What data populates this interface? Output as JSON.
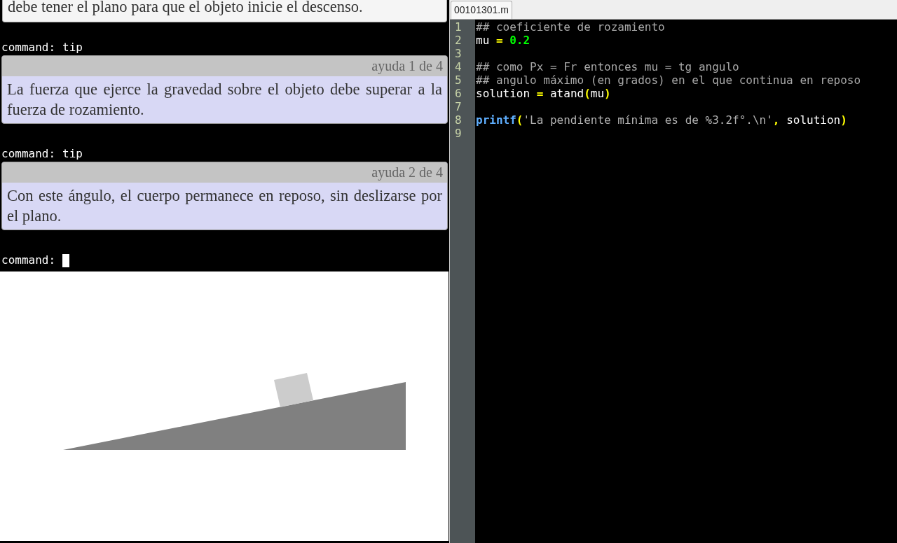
{
  "console": {
    "entries": [
      {
        "kind": "note",
        "text": "debe tener el plano para que el objeto inicie el descenso."
      },
      {
        "kind": "command",
        "prompt": "command:",
        "input": "tip"
      },
      {
        "kind": "tip",
        "header": "ayuda 1 de 4",
        "text": "La fuerza que ejerce la gravedad sobre el objeto debe superar a la fuerza de rozamiento."
      },
      {
        "kind": "command",
        "prompt": "command:",
        "input": "tip"
      },
      {
        "kind": "tip",
        "header": "ayuda 2 de 4",
        "text": "Con este ángulo, el cuerpo permanece en reposo, sin deslizarse por el plano."
      },
      {
        "kind": "prompt",
        "prompt": "command:"
      }
    ]
  },
  "editor": {
    "tab": "00101301.m",
    "lines": [
      {
        "number": "1",
        "tokens": [
          {
            "kind": "comment",
            "text": "## coeficiente de rozamiento"
          }
        ]
      },
      {
        "number": "2",
        "tokens": [
          {
            "kind": "ident",
            "text": "mu "
          },
          {
            "kind": "op",
            "text": "= "
          },
          {
            "kind": "number",
            "text": "0.2"
          }
        ]
      },
      {
        "number": "3"
      },
      {
        "number": "4",
        "tokens": [
          {
            "kind": "comment",
            "text": "## como Px = Fr entonces mu = tg angulo"
          }
        ]
      },
      {
        "number": "5",
        "tokens": [
          {
            "kind": "comment",
            "text": "## angulo máximo (en grados) en el que continua en reposo"
          }
        ]
      },
      {
        "number": "6",
        "tokens": [
          {
            "kind": "ident",
            "text": "solution "
          },
          {
            "kind": "op",
            "text": "="
          },
          {
            "kind": "ident",
            "text": " atand"
          },
          {
            "kind": "op",
            "text": "("
          },
          {
            "kind": "ident",
            "text": "mu"
          },
          {
            "kind": "op",
            "text": ")"
          }
        ]
      },
      {
        "number": "7"
      },
      {
        "number": "8",
        "tokens": [
          {
            "kind": "keyword",
            "text": "printf"
          },
          {
            "kind": "op",
            "text": "("
          },
          {
            "kind": "string",
            "text": "'La pendiente mínima es de %3.2f°.\\n'"
          },
          {
            "kind": "op",
            "text": ","
          },
          {
            "kind": "ident",
            "text": " solution"
          },
          {
            "kind": "op",
            "text": ")"
          }
        ]
      },
      {
        "number": "9"
      }
    ]
  }
}
